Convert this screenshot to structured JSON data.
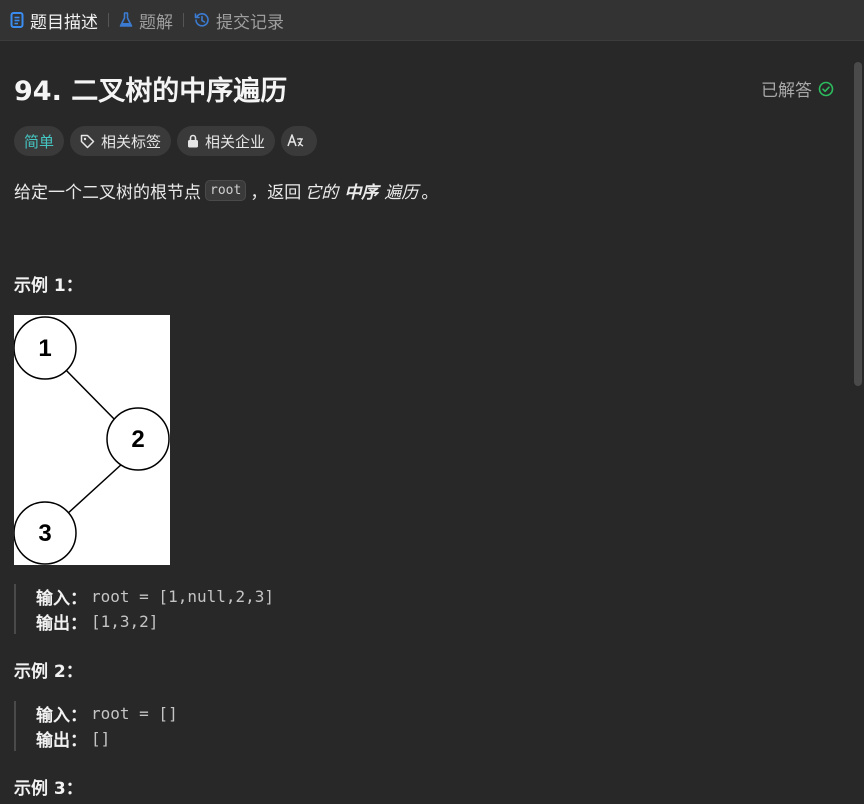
{
  "tabs": [
    {
      "label": "题目描述",
      "icon": "document-icon",
      "active": true
    },
    {
      "label": "题解",
      "icon": "flask-icon",
      "active": false
    },
    {
      "label": "提交记录",
      "icon": "history-icon",
      "active": false
    }
  ],
  "problem": {
    "title": "94. 二叉树的中序遍历",
    "status": "已解答",
    "status_color": "#2cbb5d"
  },
  "tags": {
    "difficulty": "简单",
    "difficulty_color": "#46c6c2",
    "related_tags": "相关标签",
    "related_companies": "相关企业",
    "translate_icon": "translate-icon"
  },
  "description": {
    "prefix": "给定一个二叉树的根节点",
    "code": "root",
    "middle": "，返回",
    "em1": "它的",
    "strong": "中序",
    "em2": "遍历",
    "suffix": "。"
  },
  "examples": [
    {
      "title": "示例 1：",
      "tree_nodes": [
        "1",
        "2",
        "3"
      ],
      "input_label": "输入：",
      "input_value": "root = [1,null,2,3]",
      "output_label": "输出：",
      "output_value": "[1,3,2]"
    },
    {
      "title": "示例 2：",
      "input_label": "输入：",
      "input_value": "root = []",
      "output_label": "输出：",
      "output_value": "[]"
    },
    {
      "title": "示例 3："
    }
  ]
}
